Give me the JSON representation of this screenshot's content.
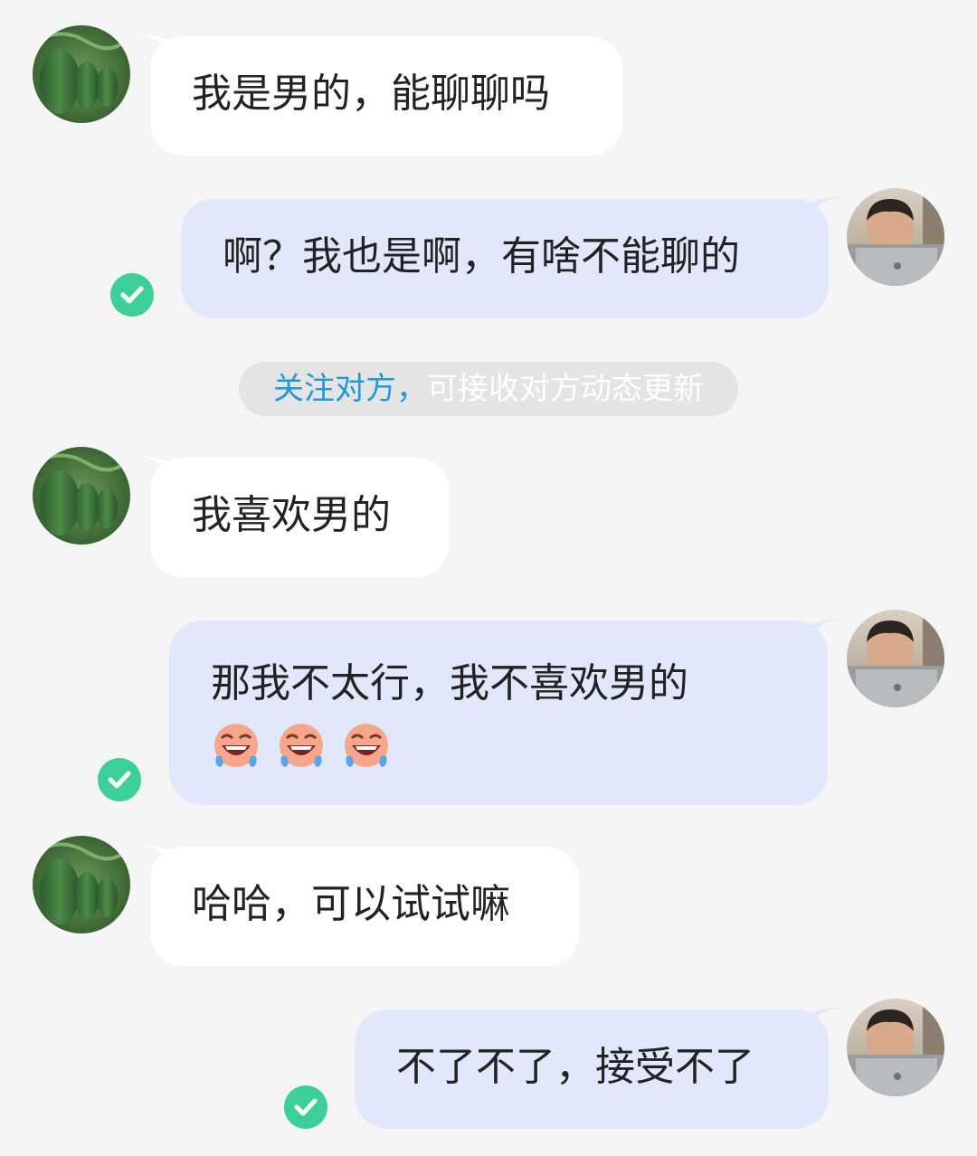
{
  "messages": [
    {
      "side": "incoming",
      "text": "我是男的，能聊聊吗"
    },
    {
      "side": "outgoing",
      "text": "啊？我也是啊，有啥不能聊的",
      "status": "read"
    },
    {
      "side": "incoming",
      "text": "我喜欢男的"
    },
    {
      "side": "outgoing",
      "text": "那我不太行，我不喜欢男的",
      "emojis": [
        "laughing-tears-emoji",
        "laughing-tears-emoji",
        "laughing-tears-emoji"
      ],
      "status": "read"
    },
    {
      "side": "incoming",
      "text": "哈哈，可以试试嘛"
    },
    {
      "side": "outgoing",
      "text": "不了不了，接受不了",
      "status": "read"
    }
  ],
  "notice": {
    "link_text": "关注对方，",
    "rest_text": "可接收对方动态更新"
  },
  "colors": {
    "background": "#f5f5f5",
    "incoming_bubble": "#ffffff",
    "outgoing_bubble": "#e1e8fb",
    "read_check": "#3dcf9a",
    "link": "#1d9bd7"
  },
  "icons": {
    "read_status": "check-circle-icon",
    "other_avatar": "winter-melon-avatar",
    "self_avatar": "user-photo-avatar"
  }
}
